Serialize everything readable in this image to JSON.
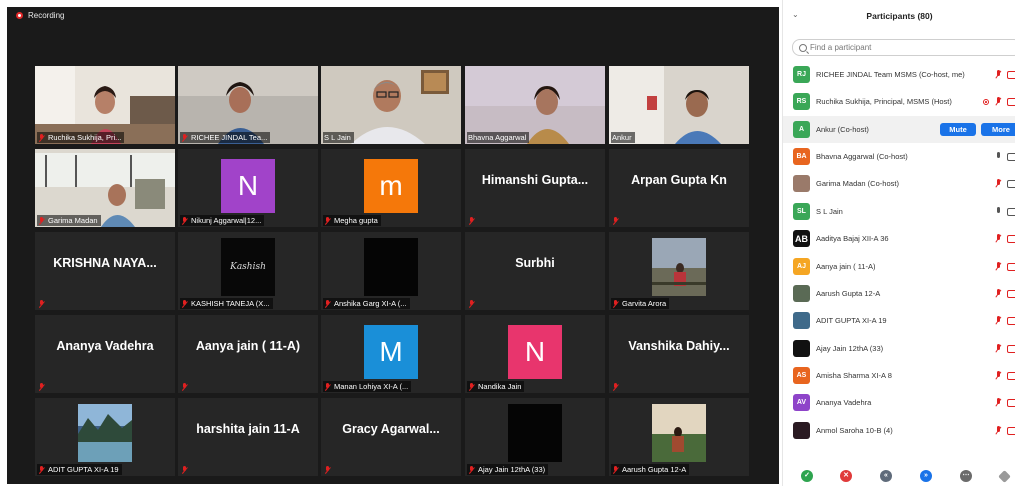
{
  "recording_label": "Recording",
  "tiles": [
    {
      "name": "Ruchika Sukhija, Pri..."
    },
    {
      "name": "RICHEE JINDAL Tea..."
    },
    {
      "name": "S L Jain"
    },
    {
      "name": "Bhavna Aggarwal"
    },
    {
      "name": "Ankur"
    },
    {
      "name": "Garima Madan"
    },
    {
      "name": "Nikunj Aggarwal|12...",
      "initial": "N",
      "color": "#a143c9"
    },
    {
      "name": "Megha gupta",
      "initial": "m",
      "color": "#f5780a"
    },
    {
      "display": "Himanshi  Gupta..."
    },
    {
      "display": "Arpan Gupta Kn"
    },
    {
      "display": "KRISHNA  NAYA..."
    },
    {
      "name": "KASHISH TANEJA (X...",
      "pic_text": "Kashish"
    },
    {
      "name": "Anshika Garg XI-A (..."
    },
    {
      "display": "Surbhi"
    },
    {
      "name": "Garvita Arora"
    },
    {
      "display": "Ananya Vadehra"
    },
    {
      "display": "Aanya jain ( 11-A)"
    },
    {
      "name": "Manan Lohiya XI-A (...",
      "initial": "M",
      "color": "#1a8fd8"
    },
    {
      "name": "Nandika Jain",
      "initial": "N",
      "color": "#e8356d"
    },
    {
      "display": "Vanshika  Dahiy..."
    },
    {
      "name": "ADIT GUPTA XI-A 19"
    },
    {
      "display": "harshita jain 11-A"
    },
    {
      "display": "Gracy  Agarwal..."
    },
    {
      "name": "Ajay Jain 12thA (33)"
    },
    {
      "name": "Aarush Gupta 12-A"
    }
  ],
  "panel": {
    "title": "Participants (80)",
    "search_placeholder": "Find a participant",
    "participants": [
      {
        "initials": "RJ",
        "color": "#3aa757",
        "name": "RICHEE JINDAL Team MSMS (Co-host, me)"
      },
      {
        "initials": "RS",
        "color": "#3aa757",
        "name": "Ruchika Sukhija, Principal, MSMS (Host)"
      },
      {
        "initials": "A",
        "color": "#3aa757",
        "name": "Ankur (Co-host)"
      },
      {
        "initials": "BA",
        "color": "#e8651f",
        "name": "Bhavna Aggarwal (Co-host)"
      },
      {
        "initials": "",
        "color": "#9a7a6a",
        "name": "Garima Madan (Co-host)"
      },
      {
        "initials": "SL",
        "color": "#3aa757",
        "name": "S L Jain"
      },
      {
        "initials": "AB",
        "color": "#111111",
        "name": "Aaditya Bajaj XII-A 36"
      },
      {
        "initials": "AJ",
        "color": "#f5a623",
        "name": "Aanya jain ( 11-A)"
      },
      {
        "initials": "",
        "color": "#5a6a55",
        "name": "Aarush Gupta 12-A"
      },
      {
        "initials": "",
        "color": "#3f6a8a",
        "name": "ADIT GUPTA XI-A 19"
      },
      {
        "initials": "",
        "color": "#111111",
        "name": "Ajay Jain 12thA (33)"
      },
      {
        "initials": "AS",
        "color": "#e8651f",
        "name": "Amisha Sharma XI-A 8"
      },
      {
        "initials": "AV",
        "color": "#8e44c9",
        "name": "Ananya Vadehra"
      },
      {
        "initials": "",
        "color": "#2a1a22",
        "name": "Anmol Saroha 10-B (4)"
      }
    ],
    "mute_label": "Mute",
    "more_label": "More"
  }
}
